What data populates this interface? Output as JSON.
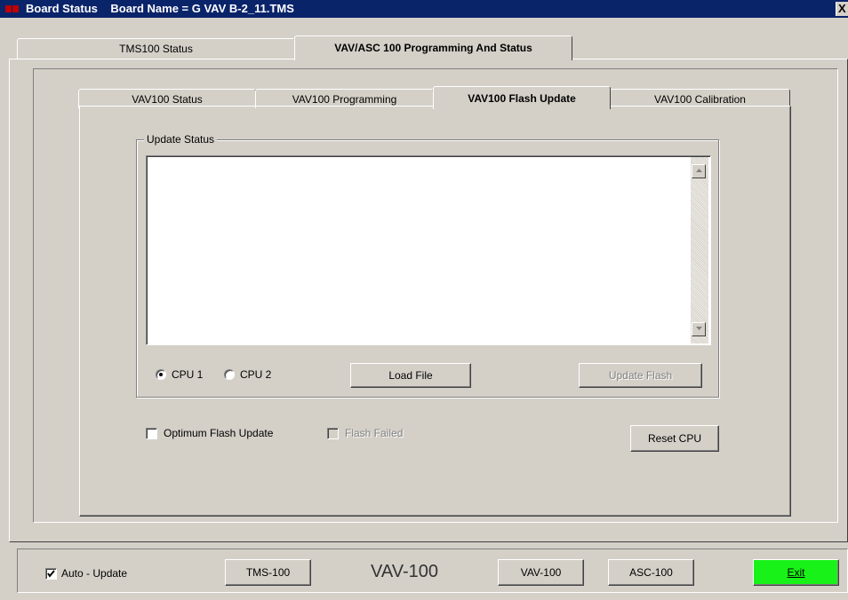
{
  "window": {
    "title_label": "Board Status",
    "board_name": "Board Name = G VAV B-2_11.TMS",
    "close_label": "X"
  },
  "outer_tabs": [
    "TMS100 Status",
    "VAV/ASC 100 Programming And Status"
  ],
  "inner_tabs": [
    "VAV100 Status",
    "VAV100 Programming",
    "VAV100 Flash Update",
    "VAV100 Calibration"
  ],
  "update_status": {
    "legend": "Update Status",
    "text": ""
  },
  "cpu": {
    "options": [
      "CPU 1",
      "CPU 2"
    ],
    "selected": "CPU 1"
  },
  "buttons": {
    "load_file": "Load File",
    "update_flash": "Update Flash",
    "reset_cpu": "Reset CPU"
  },
  "checkboxes": {
    "optimum_flash_update": {
      "label": "Optimum Flash Update",
      "checked": false
    },
    "flash_failed": {
      "label": "Flash Failed",
      "checked": false,
      "enabled": false
    }
  },
  "bottom": {
    "auto_update": {
      "label": "Auto - Update",
      "checked": true
    },
    "tms_button": "TMS-100",
    "center_label": "VAV-100",
    "vav_button": "VAV-100",
    "asc_button": "ASC-100",
    "exit_button": "Exit"
  },
  "colors": {
    "titlebar": "#0a246a",
    "face": "#d4d0c8",
    "exit_button": "#19f219"
  }
}
